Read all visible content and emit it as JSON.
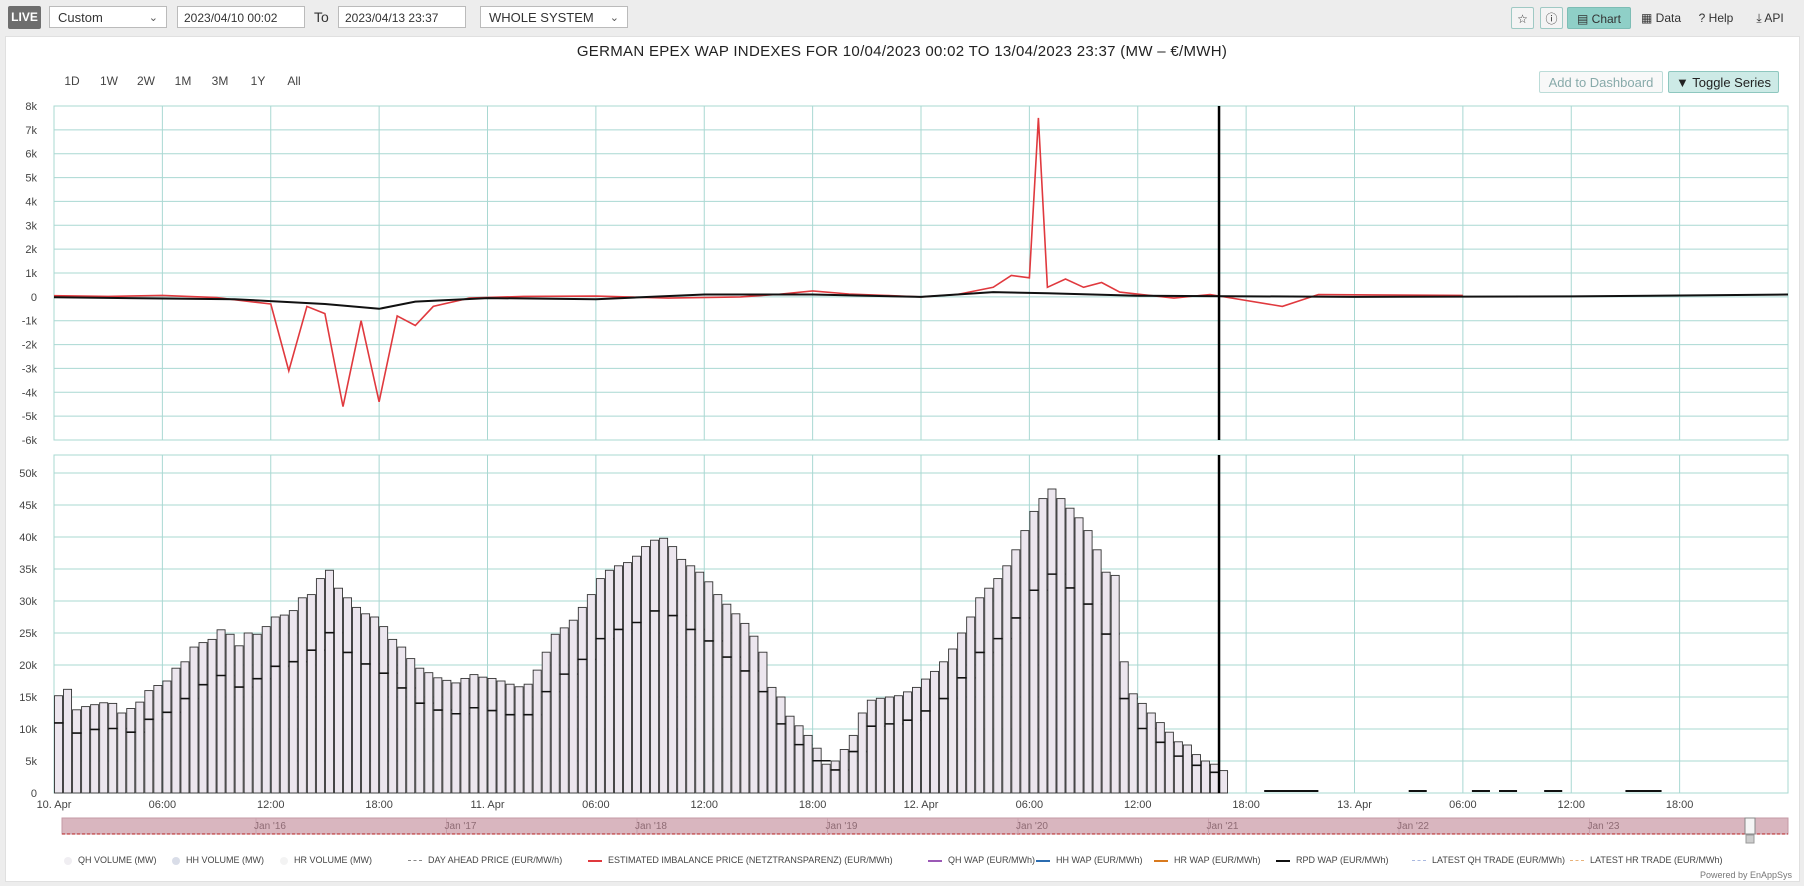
{
  "toolbar": {
    "live": "LIVE",
    "period": "Custom",
    "from": "2023/04/10 00:02",
    "to_label": "To",
    "to": "2023/04/13 23:37",
    "system": "WHOLE SYSTEM",
    "chart": "Chart",
    "data": "Data",
    "help": "Help",
    "api": "API"
  },
  "ranges": [
    "1D",
    "1W",
    "2W",
    "1M",
    "3M",
    "1Y",
    "All"
  ],
  "add_dashboard": "Add to Dashboard",
  "toggle_series": "Toggle Series",
  "powered_by": "Powered by EnAppSys",
  "colors": {
    "teal": "#8fcfc7",
    "imbalance": "#e0393e",
    "rpd": "#111111",
    "grid": "#a9d8d2",
    "bar_fill": "#ece6ee"
  },
  "chart_data": {
    "type": "bar",
    "title": "GERMAN EPEX WAP INDEXES FOR 10/04/2023 00:02 TO 13/04/2023 23:37 (MW – €/MWH)",
    "x_ticks": [
      "10. Apr",
      "06:00",
      "12:00",
      "18:00",
      "11. Apr",
      "06:00",
      "12:00",
      "18:00",
      "12. Apr",
      "06:00",
      "12:00",
      "18:00",
      "13. Apr",
      "06:00",
      "12:00",
      "18:00"
    ],
    "navigator_ticks": [
      "Jan '16",
      "Jan '17",
      "Jan '18",
      "Jan '19",
      "Jan '20",
      "Jan '21",
      "Jan '22",
      "Jan '23"
    ],
    "price_axis": {
      "ticks": [
        "8k",
        "7k",
        "6k",
        "5k",
        "4k",
        "3k",
        "2k",
        "1k",
        "0",
        "-1k",
        "-2k",
        "-3k",
        "-4k",
        "-5k",
        "-6k"
      ],
      "ylim": [
        -6000,
        8000
      ]
    },
    "volume_axis": {
      "ticks": [
        "50k",
        "45k",
        "40k",
        "35k",
        "30k",
        "25k",
        "20k",
        "15k",
        "10k",
        "5k",
        "0"
      ],
      "ylim": [
        0,
        50000
      ]
    },
    "current_time_marker_hour": 64.5,
    "imbalance_price": [
      [
        0,
        50
      ],
      [
        3,
        20
      ],
      [
        6,
        60
      ],
      [
        9,
        -30
      ],
      [
        12,
        -300
      ],
      [
        13,
        -3100
      ],
      [
        14,
        -400
      ],
      [
        15,
        -700
      ],
      [
        16,
        -4600
      ],
      [
        17,
        -1000
      ],
      [
        18,
        -4400
      ],
      [
        19,
        -800
      ],
      [
        20,
        -1200
      ],
      [
        21,
        -400
      ],
      [
        23,
        -50
      ],
      [
        26,
        20
      ],
      [
        30,
        30
      ],
      [
        34,
        -50
      ],
      [
        38,
        0
      ],
      [
        40,
        100
      ],
      [
        42,
        250
      ],
      [
        44,
        120
      ],
      [
        46,
        60
      ],
      [
        48,
        0
      ],
      [
        50,
        100
      ],
      [
        52,
        400
      ],
      [
        53,
        900
      ],
      [
        54,
        800
      ],
      [
        54.5,
        7500
      ],
      [
        55,
        400
      ],
      [
        56,
        750
      ],
      [
        57,
        400
      ],
      [
        58,
        600
      ],
      [
        59,
        200
      ],
      [
        62,
        -50
      ],
      [
        64,
        100
      ],
      [
        68,
        -400
      ],
      [
        70,
        100
      ],
      [
        73,
        80
      ],
      [
        78,
        60
      ]
    ],
    "rpd_wap": [
      [
        0,
        -20
      ],
      [
        10,
        -100
      ],
      [
        15,
        -300
      ],
      [
        18,
        -500
      ],
      [
        20,
        -200
      ],
      [
        24,
        -50
      ],
      [
        30,
        -100
      ],
      [
        36,
        100
      ],
      [
        42,
        100
      ],
      [
        48,
        0
      ],
      [
        52,
        200
      ],
      [
        55,
        150
      ],
      [
        60,
        50
      ],
      [
        72,
        0
      ],
      [
        84,
        20
      ],
      [
        96,
        100
      ]
    ],
    "hh_volume": [
      15200,
      16200,
      13000,
      13500,
      13800,
      14100,
      14000,
      12500,
      13200,
      14200,
      16000,
      16800,
      17500,
      19500,
      20500,
      22800,
      23500,
      24000,
      25500,
      24800,
      23000,
      25000,
      24800,
      26000,
      27500,
      27800,
      28500,
      30500,
      31000,
      33500,
      34800,
      32000,
      30500,
      29000,
      28000,
      27500,
      26000,
      24000,
      22800,
      21000,
      19500,
      18800,
      18000,
      17600,
      17200,
      17900,
      18500,
      18100,
      17900,
      17500,
      17000,
      16600,
      17000,
      19200,
      22000,
      24800,
      25800,
      27000,
      29000,
      31000,
      33500,
      34800,
      35500,
      36000,
      37000,
      38500,
      39500,
      39800,
      38500,
      36500,
      35500,
      34500,
      33000,
      31000,
      29500,
      28000,
      26500,
      24500,
      22000,
      16500,
      15000,
      12000,
      10500,
      9000,
      7000,
      4500,
      5000,
      6800,
      9000,
      12500,
      14500,
      14800,
      15000,
      15200,
      15800,
      16500,
      17800,
      19000,
      20500,
      22500,
      25000,
      27500,
      30500,
      32000,
      33500,
      35500,
      38000,
      41000,
      44000,
      46000,
      47500,
      46000,
      44500,
      43000,
      41000,
      38000,
      34500,
      34000,
      20500,
      15500,
      14000,
      12500,
      11000,
      9500,
      8000,
      7500,
      6000,
      5000,
      4500,
      3500,
      0
    ]
  },
  "legend": [
    {
      "label": "QH VOLUME (MW)",
      "color": "#f0eef2",
      "kind": "dot"
    },
    {
      "label": "HH VOLUME (MW)",
      "color": "#d9dde8",
      "kind": "dot"
    },
    {
      "label": "HR VOLUME (MW)",
      "color": "#f3f3f3",
      "kind": "dot"
    },
    {
      "label": "DAY AHEAD PRICE (EUR/MW/h)",
      "color": "#888888",
      "kind": "dash"
    },
    {
      "label": "ESTIMATED IMBALANCE PRICE (NETZTRANSPARENZ) (EUR/MWh)",
      "color": "#e0393e",
      "kind": "line"
    },
    {
      "label": "QH WAP (EUR/MWh)",
      "color": "#9b59b6",
      "kind": "line"
    },
    {
      "label": "HH WAP (EUR/MWh)",
      "color": "#2b6cb0",
      "kind": "line"
    },
    {
      "label": "HR WAP (EUR/MWh)",
      "color": "#d97a1e",
      "kind": "line"
    },
    {
      "label": "RPD WAP (EUR/MWh)",
      "color": "#111111",
      "kind": "line"
    },
    {
      "label": "LATEST QH TRADE (EUR/MWh)",
      "color": "#a9b8e0",
      "kind": "dash"
    },
    {
      "label": "LATEST HR TRADE (EUR/MWh)",
      "color": "#e8b27a",
      "kind": "dash"
    }
  ]
}
